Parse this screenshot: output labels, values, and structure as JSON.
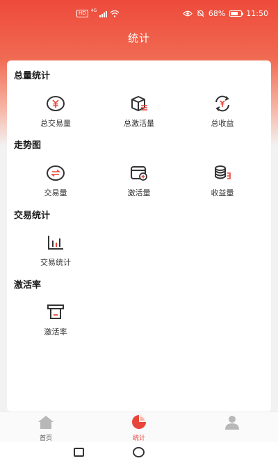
{
  "status_bar": {
    "hd": "HD",
    "net": "4G",
    "battery": "68%",
    "battery_level": 0.68,
    "time": "11:50"
  },
  "header": {
    "title": "统计"
  },
  "sections": [
    {
      "title": "总量统计",
      "items": [
        {
          "label": "总交易量",
          "icon": "yen-coin-icon"
        },
        {
          "label": "总激活量",
          "icon": "box-list-icon"
        },
        {
          "label": "总收益",
          "icon": "yen-refresh-icon"
        }
      ]
    },
    {
      "title": "走势图",
      "items": [
        {
          "label": "交易量",
          "icon": "exchange-coin-icon"
        },
        {
          "label": "激活量",
          "icon": "card-add-icon"
        },
        {
          "label": "收益量",
          "icon": "coin-stack-icon"
        }
      ]
    },
    {
      "title": "交易统计",
      "items": [
        {
          "label": "交易统计",
          "icon": "bar-chart-icon"
        }
      ]
    },
    {
      "title": "激活率",
      "items": [
        {
          "label": "激活率",
          "icon": "pos-terminal-icon"
        }
      ]
    }
  ],
  "tabbar": {
    "tabs": [
      {
        "label": "首页",
        "icon": "home-icon",
        "active": false
      },
      {
        "label": "统计",
        "icon": "pie-chart-icon",
        "active": true
      },
      {
        "label": "",
        "icon": "user-icon",
        "active": false
      }
    ]
  },
  "colors": {
    "accent": "#e8453b",
    "icon_dark": "#333333",
    "inactive": "#b8b8b8"
  }
}
